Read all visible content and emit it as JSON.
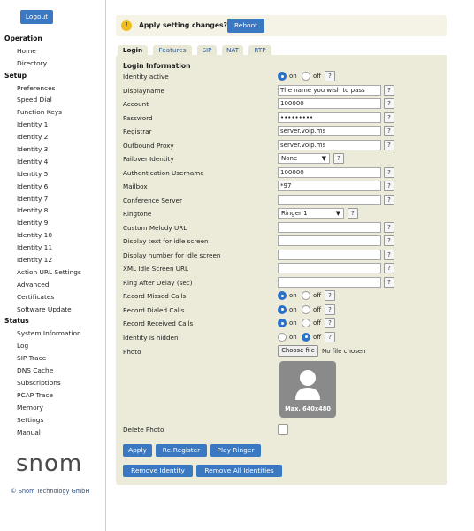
{
  "sidebar": {
    "logout_label": "Logout",
    "sections": [
      {
        "title": "Operation",
        "items": [
          "Home",
          "Directory"
        ]
      },
      {
        "title": "Setup",
        "items": [
          "Preferences",
          "Speed Dial",
          "Function Keys",
          "Identity 1",
          "Identity 2",
          "Identity 3",
          "Identity 4",
          "Identity 5",
          "Identity 6",
          "Identity 7",
          "Identity 8",
          "Identity 9",
          "Identity 10",
          "Identity 11",
          "Identity 12",
          "Action URL Settings",
          "Advanced",
          "Certificates",
          "Software Update"
        ]
      },
      {
        "title": "Status",
        "items": [
          "System Information",
          "Log",
          "SIP Trace",
          "DNS Cache",
          "Subscriptions",
          "PCAP Trace",
          "Memory",
          "Settings",
          "Manual"
        ]
      }
    ],
    "logo_text": "snom",
    "copyright": "© Snom Technology GmbH"
  },
  "banner": {
    "icon": "exclamation-icon",
    "text": "Apply setting changes?",
    "reboot_label": "Reboot",
    "colors": {
      "bg": "#f4f3e6",
      "icon": "#f0bd1e",
      "button": "#3a78c2"
    }
  },
  "tabs": [
    "Login",
    "Features",
    "SIP",
    "NAT",
    "RTP"
  ],
  "active_tab": "Login",
  "form": {
    "section_title": "Login Information",
    "help_glyph": "?",
    "on_label": "on",
    "off_label": "off",
    "identity_active": {
      "label": "Identity active",
      "value": "on"
    },
    "displayname": {
      "label": "Displayname",
      "value": "The name you wish to pass"
    },
    "account": {
      "label": "Account",
      "value": "100000"
    },
    "password": {
      "label": "Password",
      "value": "•••••••••"
    },
    "registrar": {
      "label": "Registrar",
      "value": "server.voip.ms"
    },
    "outbound_proxy": {
      "label": "Outbound Proxy",
      "value": "server.voip.ms"
    },
    "failover_identity": {
      "label": "Failover Identity",
      "value": "None"
    },
    "auth_username": {
      "label": "Authentication Username",
      "value": "100000"
    },
    "mailbox": {
      "label": "Mailbox",
      "value": "*97"
    },
    "conference_server": {
      "label": "Conference Server",
      "value": ""
    },
    "ringtone": {
      "label": "Ringtone",
      "value": "Ringer 1"
    },
    "custom_melody_url": {
      "label": "Custom Melody URL",
      "value": ""
    },
    "idle_text": {
      "label": "Display text for idle screen",
      "value": ""
    },
    "idle_number": {
      "label": "Display number for idle screen",
      "value": ""
    },
    "xml_idle_url": {
      "label": "XML Idle Screen URL",
      "value": ""
    },
    "ring_after_delay": {
      "label": "Ring After Delay (sec)",
      "value": ""
    },
    "record_missed": {
      "label": "Record Missed Calls",
      "value": "on"
    },
    "record_dialed": {
      "label": "Record Dialed Calls",
      "value": "on"
    },
    "record_received": {
      "label": "Record Received Calls",
      "value": "on"
    },
    "identity_hidden": {
      "label": "Identity is hidden",
      "value": "off"
    },
    "photo": {
      "label": "Photo",
      "choose_label": "Choose file",
      "file_status": "No file chosen",
      "placeholder_caption": "Max. 640x480",
      "placeholder_icon": "user-silhouette-icon"
    },
    "delete_photo": {
      "label": "Delete Photo",
      "checked": false
    }
  },
  "actions": {
    "apply": "Apply",
    "reregister": "Re-Register",
    "play_ringer": "Play Ringer",
    "remove_identity": "Remove Identity",
    "remove_all": "Remove All Identities"
  }
}
